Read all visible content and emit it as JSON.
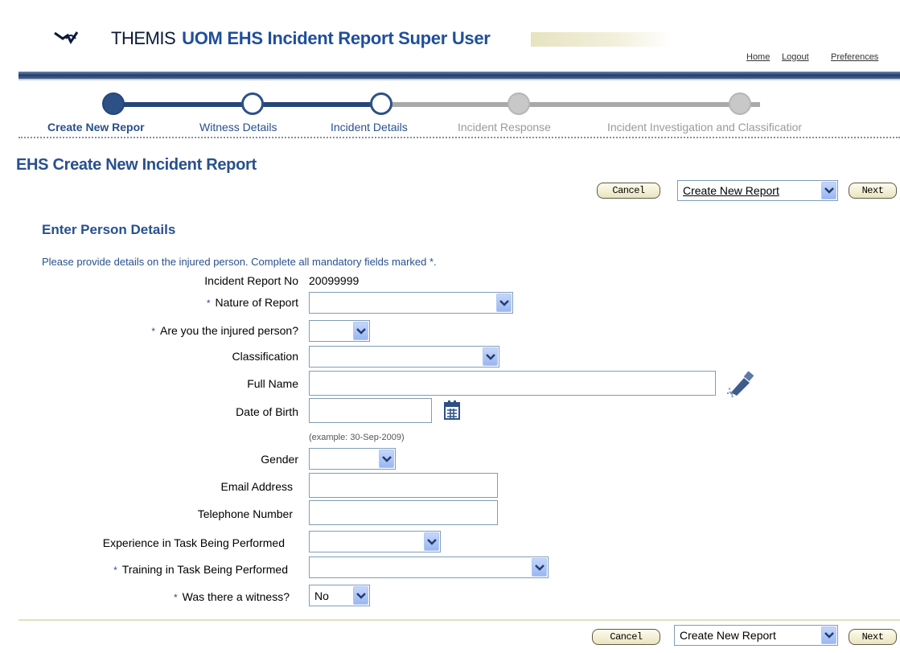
{
  "header": {
    "brand_word": "THEMIS",
    "app_title": "UOM EHS Incident Report Super User",
    "links": {
      "home": "Home",
      "logout": "Logout",
      "preferences": "Preferences"
    }
  },
  "train": {
    "steps": [
      {
        "label": "Create New Repor",
        "state": "current"
      },
      {
        "label": "Witness Details",
        "state": "enabled"
      },
      {
        "label": "Incident Details",
        "state": "enabled"
      },
      {
        "label": "Incident Response",
        "state": "disabled"
      },
      {
        "label": "Incident Investigation and Classificatior",
        "state": "disabled"
      }
    ]
  },
  "page_title": "EHS Create New Incident Report",
  "top_actions": {
    "cancel": "Cancel",
    "nav_select": "Create New Report",
    "next": "Next"
  },
  "section_title": "Enter Person Details",
  "instruction": "Please provide details on the injured person. Complete all mandatory fields marked *.",
  "required_marker": "*",
  "fields": {
    "report_no": {
      "label": "Incident Report No",
      "value": "20099999"
    },
    "nature": {
      "label": "Nature of Report",
      "value": ""
    },
    "injured": {
      "label": "Are you the injured person?",
      "value": ""
    },
    "classification": {
      "label": "Classification",
      "value": ""
    },
    "full_name": {
      "label": "Full Name",
      "value": ""
    },
    "dob": {
      "label": "Date of Birth",
      "value": "",
      "hint": "(example: 30-Sep-2009)"
    },
    "gender": {
      "label": "Gender",
      "value": ""
    },
    "email": {
      "label": "Email Address",
      "value": ""
    },
    "phone": {
      "label": "Telephone Number",
      "value": ""
    },
    "experience": {
      "label": "Experience in Task Being Performed",
      "value": ""
    },
    "training": {
      "label": "Training in Task Being Performed",
      "value": ""
    },
    "witness": {
      "label": "Was there a witness?",
      "value": "No"
    }
  },
  "bottom_actions": {
    "cancel": "Cancel",
    "nav_select": "Create New Report",
    "next": "Next"
  },
  "icons": {
    "flashlight": "flashlight-icon",
    "calendar": "calendar-icon",
    "dropdown": "chevron-down-icon"
  },
  "colors": {
    "accent": "#28508e",
    "train_done": "#2d5186",
    "train_disabled": "#c8c8c8",
    "button_bg": "#fefcec"
  }
}
